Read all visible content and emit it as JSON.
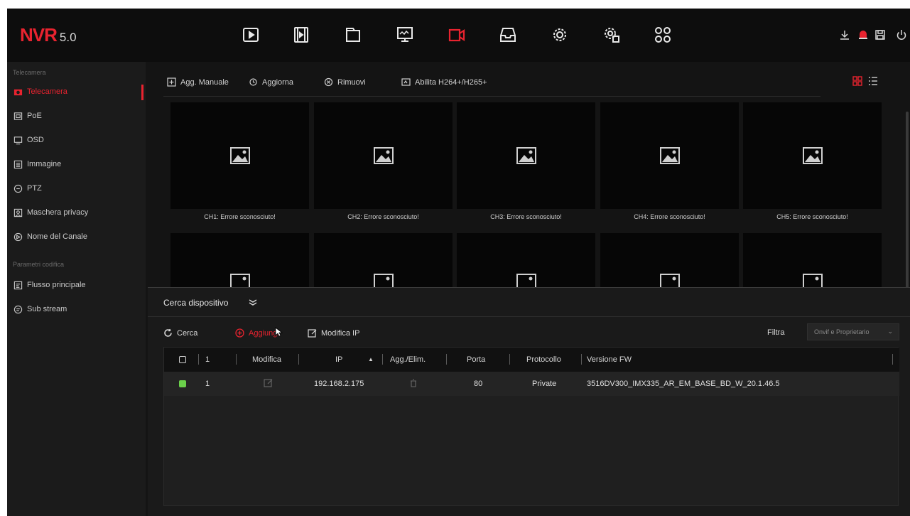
{
  "app": {
    "logo": "NVR",
    "version": "5.0"
  },
  "colors": {
    "accent": "#e8232f",
    "online": "#6ad04a"
  },
  "topnav": [
    {
      "icon": "playback-icon"
    },
    {
      "icon": "film-icon"
    },
    {
      "icon": "file-icon"
    },
    {
      "icon": "monitor-icon"
    },
    {
      "icon": "camera-icon",
      "active": true
    },
    {
      "icon": "storage-icon"
    },
    {
      "icon": "settings-icon"
    },
    {
      "icon": "system-settings-icon"
    },
    {
      "icon": "apps-icon"
    }
  ],
  "topright": [
    "download-icon",
    "alarm-icon",
    "save-icon",
    "power-icon"
  ],
  "sidebar": {
    "section1": "Telecamera",
    "section2": "Parametri codifica",
    "items": [
      {
        "label": "Telecamera",
        "icon": "camera-icon"
      },
      {
        "label": "PoE",
        "icon": "poe-icon"
      },
      {
        "label": "OSD",
        "icon": "osd-icon"
      },
      {
        "label": "Immagine",
        "icon": "image-icon"
      },
      {
        "label": "PTZ",
        "icon": "ptz-icon"
      },
      {
        "label": "Maschera privacy",
        "icon": "privacy-mask-icon"
      },
      {
        "label": "Nome del Canale",
        "icon": "channel-name-icon"
      },
      {
        "label": "Flusso principale",
        "icon": "main-stream-icon"
      },
      {
        "label": "Sub stream",
        "icon": "sub-stream-icon"
      }
    ]
  },
  "toolbar": {
    "add_manual": "Agg. Manuale",
    "update": "Aggiorna",
    "remove": "Rimuovi",
    "enable_h264": "Abilita H264+/H265+"
  },
  "channels": [
    "CH1: Errore sconosciuto!",
    "CH2: Errore sconosciuto!",
    "CH3: Errore sconosciuto!",
    "CH4: Errore sconosciuto!",
    "CH5: Errore sconosciuto!"
  ],
  "search_panel": {
    "title": "Cerca dispositivo",
    "search": "Cerca",
    "add": "Aggiungi",
    "modify_ip": "Modifica IP",
    "filter_label": "Filtra",
    "filter_value": "Onvif e Proprietario",
    "columns": {
      "count": "1",
      "modify": "Modifica",
      "ip": "IP",
      "add_remove": "Agg./Elim.",
      "port": "Porta",
      "protocol": "Protocollo",
      "fw": "Versione FW"
    },
    "rows": [
      {
        "index": "1",
        "ip": "192.168.2.175",
        "port": "80",
        "protocol": "Private",
        "fw": "3516DV300_IMX335_AR_EM_BASE_BD_W_20.1.46.5"
      }
    ]
  }
}
